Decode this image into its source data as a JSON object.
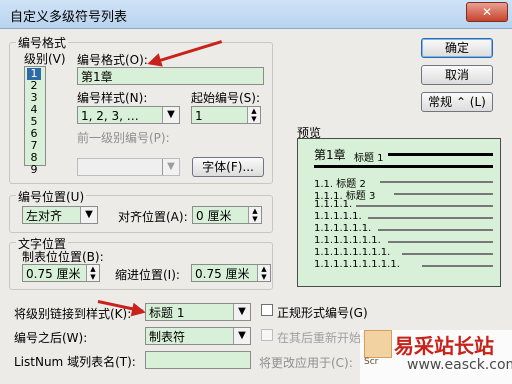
{
  "window": {
    "title": "自定义多级符号列表",
    "close_glyph": "✕"
  },
  "groups": {
    "numbering_format": "编号格式",
    "numbering_position": "编号位置(U)",
    "text_position": "文字位置",
    "preview": "预览"
  },
  "levels": {
    "label": "级别(V)",
    "items": [
      "1",
      "2",
      "3",
      "4",
      "5",
      "6",
      "7",
      "8",
      "9"
    ],
    "selected": "1"
  },
  "fields": {
    "number_format_label": "编号格式(O):",
    "number_format_value": "第1章",
    "number_style_label": "编号样式(N):",
    "number_style_value": "1, 2, 3, …",
    "start_at_label": "起始编号(S):",
    "start_at_value": "1",
    "prev_level_label": "前一级别编号(P):",
    "prev_level_value": "",
    "alignment_value": "左对齐",
    "align_at_label": "对齐位置(A):",
    "align_at_value": "0 厘米",
    "tab_after_label": "制表位位置(B):",
    "tab_after_value": "0.75 厘米",
    "indent_at_label": "缩进位置(I):",
    "indent_at_value": "0.75 厘米",
    "link_style_label": "将级别链接到样式(K):",
    "link_style_value": "标题 1",
    "follow_number_label": "编号之后(W):",
    "follow_number_value": "制表符",
    "listnum_label": "ListNum 域列表名(T):",
    "listnum_value": "",
    "apply_to_label": "将更改应用于(C):"
  },
  "checkboxes": {
    "legal_style": "正规形式编号(G)",
    "restart_after": "在其后重新开始编号"
  },
  "buttons": {
    "ok": "确定",
    "cancel": "取消",
    "less": "常规 ⌃ (L)",
    "font": "字体(F)..."
  },
  "preview": {
    "line1_num": "第1章",
    "line1_text": "标题 1",
    "line2_text": "1.1. 标题 2",
    "line3_text": "1.1.1. 标题 3",
    "nums": [
      "1.1.1.1.",
      "1.1.1.1.1.",
      "1.1.1.1.1.1.",
      "1.1.1.1.1.1.1.",
      "1.1.1.1.1.1.1.1.",
      "1.1.1.1.1.1.1.1.1."
    ]
  },
  "watermark": {
    "site": "易采站长站",
    "url": "www.easck.com",
    "logo_text": "Scr"
  }
}
